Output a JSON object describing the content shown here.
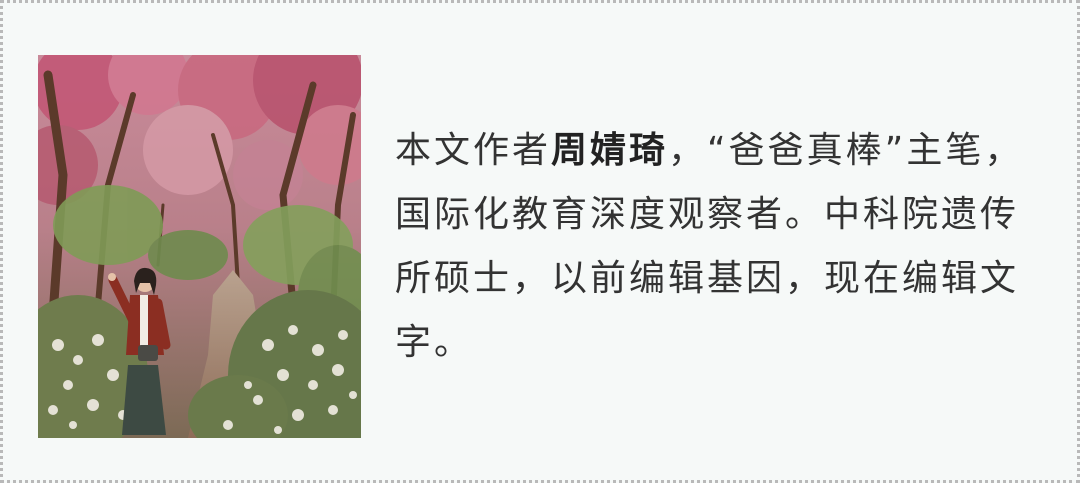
{
  "author_card": {
    "bio_prefix": "本文作者",
    "author_name": "周婧琦",
    "bio_rest": "，“爸爸真棒”主笔，国际化教育深度观察者。中科院遗传所硕士，以前编辑基因，现在编辑文字。"
  },
  "colors": {
    "card_background": "#f6f9f8",
    "border": "#b9b9b9",
    "text": "#333333"
  }
}
